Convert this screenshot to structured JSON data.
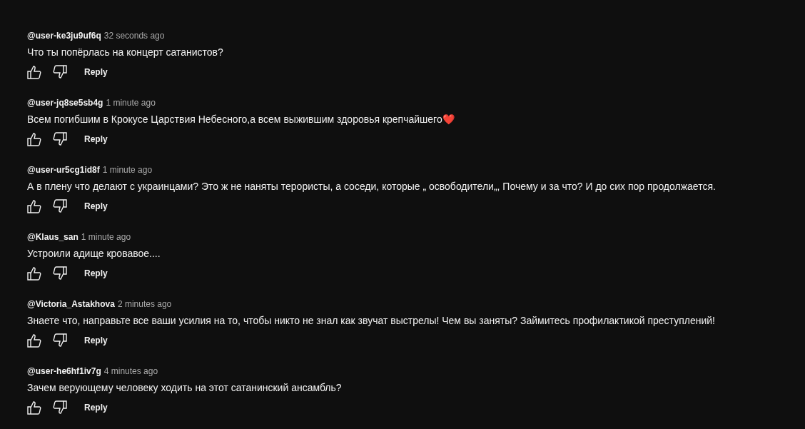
{
  "comments": [
    {
      "author": "@user-ke3ju9uf6q",
      "time": "32 seconds ago",
      "text": "Что ты попёрлась на концерт сатанистов?",
      "reply": "Reply"
    },
    {
      "author": "@user-jq8se5sb4g",
      "time": "1 minute ago",
      "text": "Всем погибшим в Крокусе Царствия Небесного,а всем выжившим здоровья крепчайшего❤️",
      "reply": "Reply"
    },
    {
      "author": "@user-ur5cg1id8f",
      "time": "1 minute ago",
      "text": "А в плену что делают с украинцами? Это ж не наняты терористы, а соседи, которые „ освободители„, Почему и за что? И до сих пор продолжается.",
      "reply": "Reply"
    },
    {
      "author": "@Klaus_san",
      "time": "1 minute ago",
      "text": "Устроили адище кровавое....",
      "reply": "Reply"
    },
    {
      "author": "@Victoria_Astakhova",
      "time": "2 minutes ago",
      "text": "Знаете что, направьте все ваши усилия на то, чтобы никто не знал как звучат выстрелы! Чем вы заняты? Займитесь профилактикой преступлений!",
      "reply": "Reply"
    },
    {
      "author": "@user-he6hf1iv7g",
      "time": "4 minutes ago",
      "text": "Зачем верующему человеку ходить на этот сатанинский ансамбль?",
      "reply": "Reply"
    }
  ]
}
